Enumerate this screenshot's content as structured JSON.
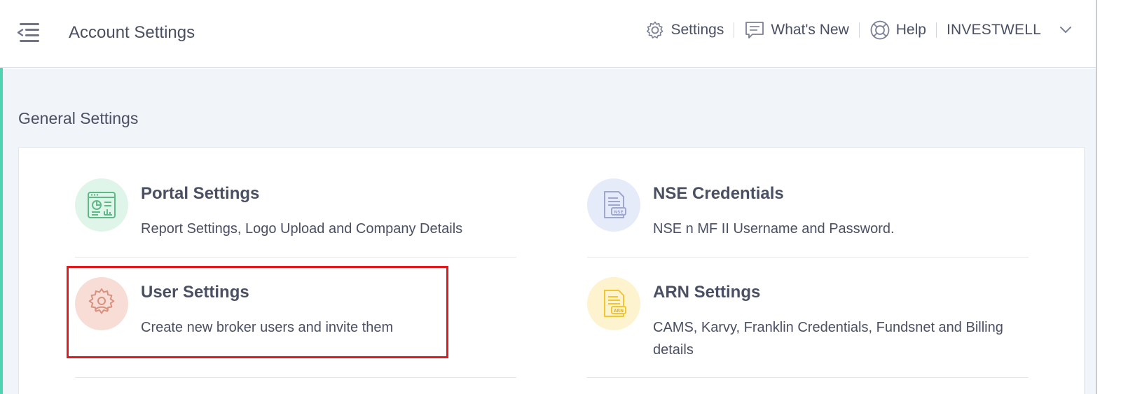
{
  "header": {
    "title": "Account Settings",
    "nav": {
      "settings_label": "Settings",
      "whats_new_label": "What's New",
      "help_label": "Help",
      "account_label": "INVESTWELL"
    }
  },
  "main": {
    "section_title": "General Settings",
    "settings": [
      {
        "title": "Portal Settings",
        "description": "Report Settings, Logo Upload and Company Details",
        "icon": "portal-dashboard-icon",
        "color": "#dff5e9"
      },
      {
        "title": "NSE Credentials",
        "description": "NSE n MF II Username and Password.",
        "icon": "nse-document-icon",
        "color": "#e6ebfa"
      },
      {
        "title": "User Settings",
        "description": "Create new broker users and invite them",
        "icon": "user-gear-icon",
        "color": "#f8ddd7"
      },
      {
        "title": "ARN Settings",
        "description": "CAMS, Karvy, Franklin Credentials, Fundsnet and Billing details",
        "icon": "arn-document-icon",
        "color": "#fdf3cf"
      }
    ]
  },
  "colors": {
    "accent": "#4fd3b0",
    "highlight": "#e3191c",
    "text": "#4a4f63",
    "background": "#f1f4f9"
  }
}
